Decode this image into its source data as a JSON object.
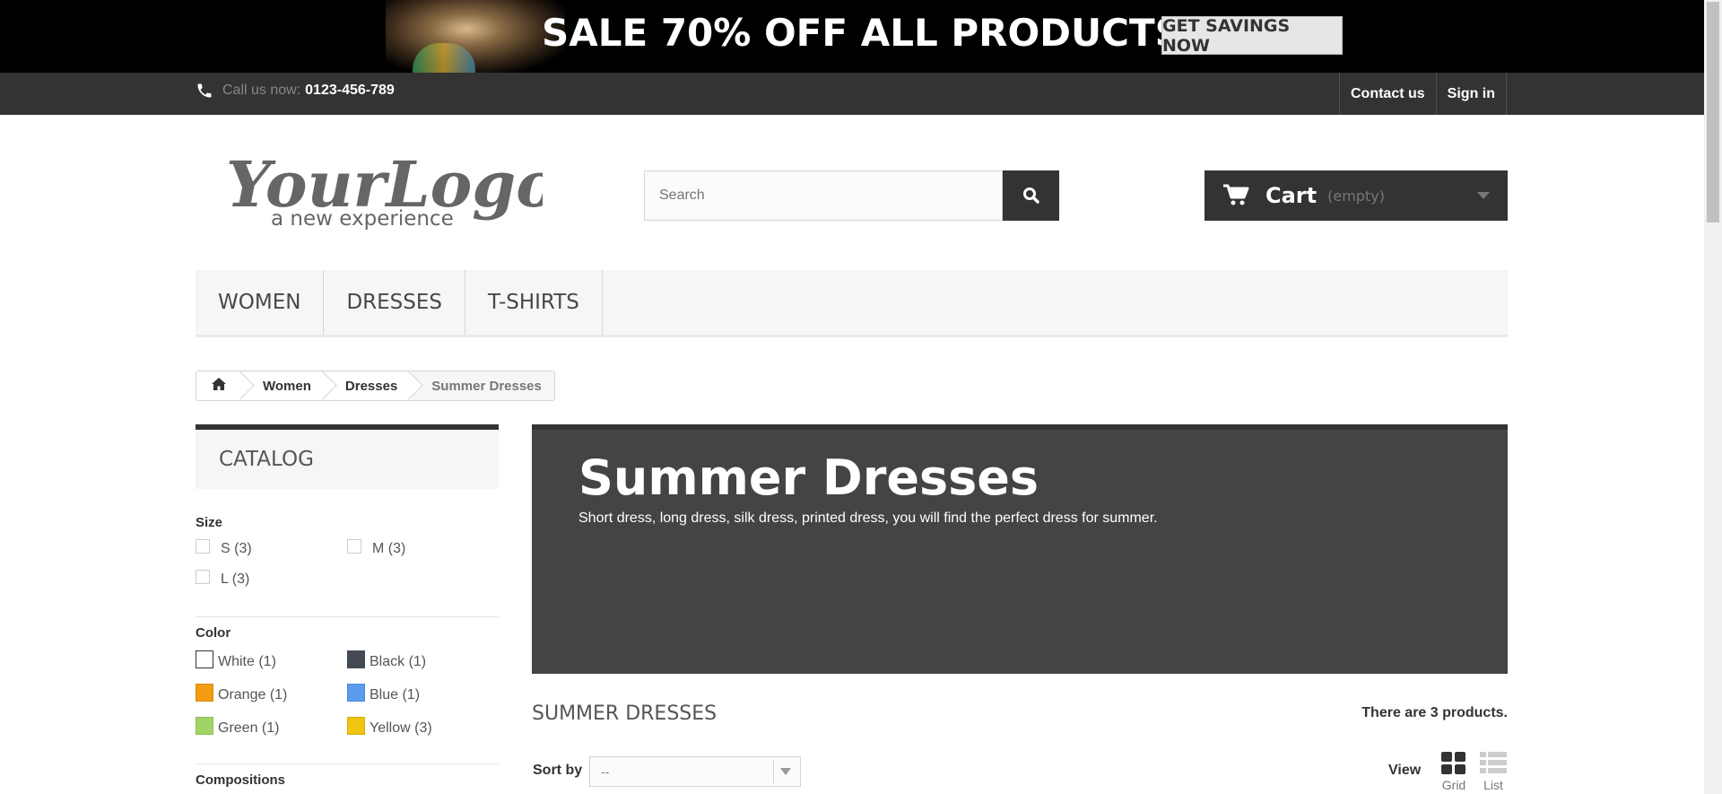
{
  "banner": {
    "headline": "SALE 70% OFF ALL PRODUCTS",
    "cta": "GET SAVINGS NOW"
  },
  "topbar": {
    "call_label": "Call us now:",
    "phone": "0123-456-789",
    "contact": "Contact us",
    "signin": "Sign in"
  },
  "logo": {
    "main": "YourLogo",
    "tagline": "a new experience"
  },
  "search": {
    "placeholder": "Search",
    "value": ""
  },
  "cart": {
    "label": "Cart",
    "status": "(empty)"
  },
  "menu": {
    "items": [
      "WOMEN",
      "DRESSES",
      "T-SHIRTS"
    ]
  },
  "breadcrumb": {
    "items": [
      "Women",
      "Dresses",
      "Summer Dresses"
    ]
  },
  "sidebar": {
    "title": "CATALOG",
    "size": {
      "title": "Size",
      "options": [
        "S (3)",
        "M (3)",
        "L (3)"
      ]
    },
    "color": {
      "title": "Color",
      "options": [
        {
          "label": "White (1)",
          "color": "#ffffff"
        },
        {
          "label": "Black (1)",
          "color": "#434a54"
        },
        {
          "label": "Orange (1)",
          "color": "#f39c11"
        },
        {
          "label": "Blue (1)",
          "color": "#5d9cec"
        },
        {
          "label": "Green (1)",
          "color": "#a0d468"
        },
        {
          "label": "Yellow (3)",
          "color": "#f1c40f"
        }
      ]
    },
    "compositions": {
      "title": "Compositions"
    }
  },
  "category": {
    "name": "Summer Dresses",
    "description": "Short dress, long dress, silk dress, printed dress, you will find the perfect dress for summer.",
    "heading": "SUMMER DRESSES",
    "count": "There are 3 products.",
    "sort_label": "Sort by",
    "sort_value": "--",
    "view_label": "View",
    "view_grid": "Grid",
    "view_list": "List"
  }
}
